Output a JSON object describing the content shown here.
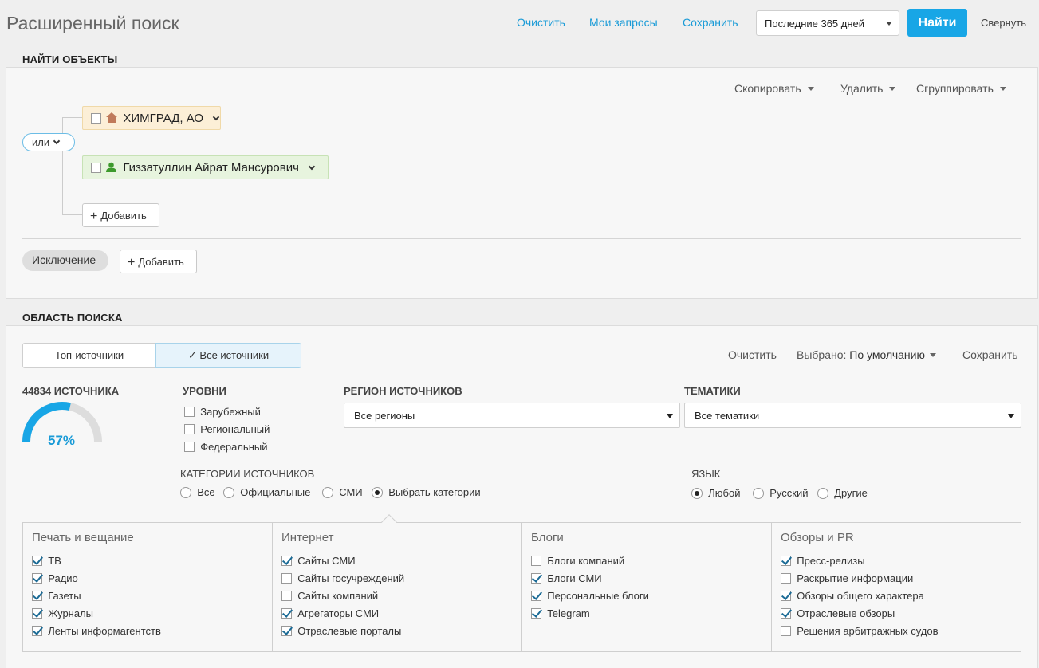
{
  "header": {
    "title": "Расширенный поиск",
    "clear": "Очистить",
    "my_queries": "Мои запросы",
    "save": "Сохранить",
    "period": "Последние 365 дней",
    "find": "Найти",
    "collapse": "Свернуть"
  },
  "find_objects": {
    "title": "НАЙТИ ОБЪЕКТЫ",
    "copy": "Скопировать",
    "delete": "Удалить",
    "group": "Сгруппировать",
    "operator": "или",
    "objects": [
      {
        "label": "ХИМГРАД, АО",
        "type": "company",
        "icon": "building-icon"
      },
      {
        "label": "Гиззатуллин Айрат Мансурович",
        "type": "person",
        "icon": "person-icon"
      }
    ],
    "add": "Добавить",
    "exclusion": "Исключение",
    "exclusion_add": "Добавить"
  },
  "search_area": {
    "title": "ОБЛАСТЬ ПОИСКА",
    "tabs": [
      "Топ-источники",
      "Все источники"
    ],
    "active_tab": "Все источники",
    "clear": "Очистить",
    "selected_label": "Выбрано:",
    "selected_value": "По умолчанию",
    "save": "Сохранить",
    "sources_count": "44834 ИСТОЧНИКА",
    "gauge_percent": "57%",
    "gauge_value": 0.57,
    "levels_title": "УРОВНИ",
    "levels": [
      {
        "label": "Зарубежный",
        "checked": false
      },
      {
        "label": "Региональный",
        "checked": false
      },
      {
        "label": "Федеральный",
        "checked": false
      }
    ],
    "region_title": "РЕГИОН ИСТОЧНИКОВ",
    "region_value": "Все регионы",
    "topics_title": "ТЕМАТИКИ",
    "topics_value": "Все тематики",
    "categories_title": "КАТЕГОРИИ ИСТОЧНИКОВ",
    "categories_options": [
      "Все",
      "Официальные",
      "СМИ",
      "Выбрать категории"
    ],
    "categories_selected": "Выбрать категории",
    "language_title": "ЯЗЫК",
    "language_options": [
      "Любой",
      "Русский",
      "Другие"
    ],
    "language_selected": "Любой",
    "accent_color": "#18a6e6"
  },
  "category_groups": [
    {
      "title": "Печать и вещание",
      "items": [
        {
          "label": "ТВ",
          "checked": true
        },
        {
          "label": "Радио",
          "checked": true
        },
        {
          "label": "Газеты",
          "checked": true
        },
        {
          "label": "Журналы",
          "checked": true
        },
        {
          "label": "Ленты информагентств",
          "checked": true
        }
      ]
    },
    {
      "title": "Интернет",
      "items": [
        {
          "label": "Сайты СМИ",
          "checked": true
        },
        {
          "label": "Сайты госучреждений",
          "checked": false
        },
        {
          "label": "Сайты компаний",
          "checked": false
        },
        {
          "label": "Агрегаторы СМИ",
          "checked": true
        },
        {
          "label": "Отраслевые порталы",
          "checked": true
        }
      ]
    },
    {
      "title": "Блоги",
      "items": [
        {
          "label": "Блоги компаний",
          "checked": false
        },
        {
          "label": "Блоги СМИ",
          "checked": true
        },
        {
          "label": "Персональные блоги",
          "checked": true
        },
        {
          "label": "Telegram",
          "checked": true
        }
      ]
    },
    {
      "title": "Обзоры и PR",
      "items": [
        {
          "label": "Пресс-релизы",
          "checked": true
        },
        {
          "label": "Раскрытие информации",
          "checked": false
        },
        {
          "label": "Обзоры общего характера",
          "checked": true
        },
        {
          "label": "Отраслевые обзоры",
          "checked": true
        },
        {
          "label": "Решения арбитражных судов",
          "checked": false
        }
      ]
    }
  ]
}
